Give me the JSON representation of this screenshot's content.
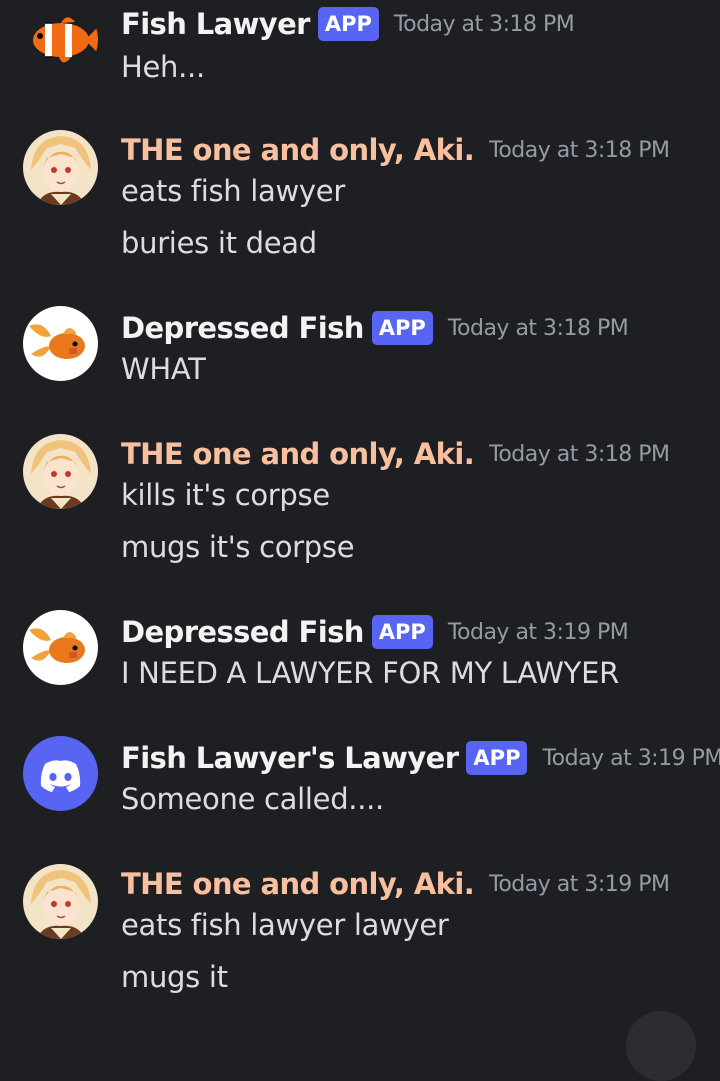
{
  "messages": [
    {
      "username": "Fish Lawyer",
      "name_color": "#f2f3f5",
      "badge": "APP",
      "timestamp": "Today at 3:18 PM",
      "avatar_icon": "clownfish-icon",
      "lines": [
        "Heh..."
      ]
    },
    {
      "username": "THE one and only, Aki.",
      "name_color": "#f9c0a0",
      "badge": null,
      "timestamp": "Today at 3:18 PM",
      "avatar_icon": "anime-character-icon",
      "lines": [
        "eats fish lawyer",
        "buries it dead"
      ]
    },
    {
      "username": "Depressed Fish",
      "name_color": "#f2f3f5",
      "badge": "APP",
      "timestamp": "Today at 3:18 PM",
      "avatar_icon": "goldfish-icon",
      "lines": [
        "WHAT"
      ]
    },
    {
      "username": "THE one and only, Aki.",
      "name_color": "#f9c0a0",
      "badge": null,
      "timestamp": "Today at 3:18 PM",
      "avatar_icon": "anime-character-icon",
      "lines": [
        "kills it's corpse",
        "mugs it's corpse"
      ]
    },
    {
      "username": "Depressed Fish",
      "name_color": "#f2f3f5",
      "badge": "APP",
      "timestamp": "Today at 3:19 PM",
      "avatar_icon": "goldfish-icon",
      "lines": [
        "I NEED A LAWYER FOR MY LAWYER"
      ]
    },
    {
      "username": "Fish Lawyer's Lawyer",
      "name_color": "#f2f3f5",
      "badge": "APP",
      "timestamp": "Today at 3:19 PM",
      "avatar_icon": "discord-logo-icon",
      "lines": [
        "Someone called...."
      ]
    },
    {
      "username": "THE one and only, Aki.",
      "name_color": "#f9c0a0",
      "badge": null,
      "timestamp": "Today at 3:19 PM",
      "avatar_icon": "anime-character-icon",
      "lines": [
        "eats fish lawyer lawyer",
        "mugs it"
      ]
    }
  ],
  "colors": {
    "background": "#1e1f22",
    "badge": "#5865f2",
    "timestamp": "#949ba4",
    "message_text": "#dbdee1"
  }
}
